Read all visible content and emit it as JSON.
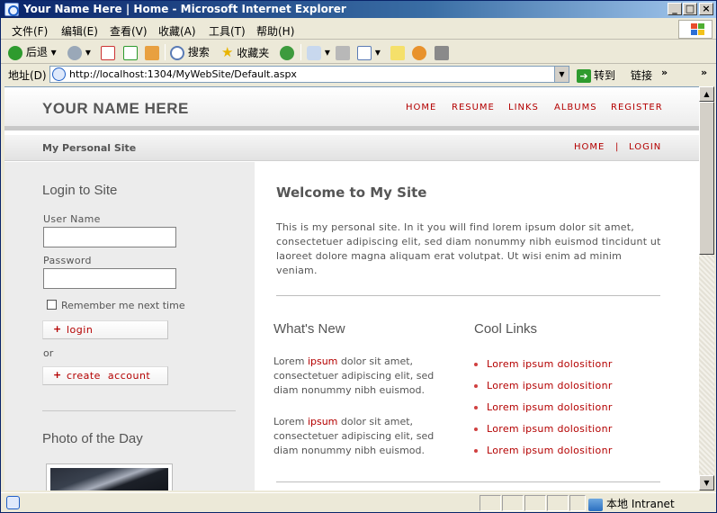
{
  "window": {
    "title": "Your Name Here | Home - Microsoft Internet Explorer",
    "minimize": "_",
    "maximize": "□",
    "close": "×"
  },
  "menu": [
    "文件(F)",
    "编辑(E)",
    "查看(V)",
    "收藏(A)",
    "工具(T)",
    "帮助(H)"
  ],
  "toolbar": {
    "back": "后退",
    "search": "搜索",
    "favorites": "收藏夹"
  },
  "address": {
    "label": "地址(D)",
    "url": "http://localhost:1304/MyWebSite/Default.aspx",
    "go": "转到",
    "links": "链接",
    "more": "»"
  },
  "site": {
    "name": "YOUR NAME HERE",
    "tagline": "My Personal Site",
    "top_nav": [
      "HOME",
      "RESUME",
      "LINKS",
      "ALBUMS",
      "REGISTER"
    ],
    "sub_nav": [
      "HOME",
      "LOGIN"
    ],
    "sub_sep": "|"
  },
  "sidebar": {
    "login_heading": "Login to Site",
    "username_label": "User Name",
    "password_label": "Password",
    "remember": "Remember me next time",
    "login_button": "login",
    "or": "or",
    "create_button": "create  account",
    "photo_heading": "Photo of the Day"
  },
  "main": {
    "welcome": "Welcome to My Site",
    "intro": "This is my personal site. In it you will find lorem ipsum dolor sit amet, consectetuer adipiscing elit, sed diam nonummy nibh euismod tincidunt ut laoreet dolore magna aliquam erat volutpat. Ut wisi enim ad minim veniam.",
    "whats_new_heading": "What's New",
    "news": [
      {
        "pre": "Lorem ",
        "hl": "ipsum",
        "post": " dolor sit amet, consectetuer adipiscing elit, sed diam nonummy nibh euismod."
      },
      {
        "pre": "Lorem ",
        "hl": "ipsum",
        "post": " dolor sit amet, consectetuer adipiscing elit, sed diam nonummy nibh euismod."
      }
    ],
    "cool_links_heading": "Cool Links",
    "cool_links": [
      "Lorem ipsum dolositionr",
      "Lorem ipsum dolositionr",
      "Lorem ipsum dolositionr",
      "Lorem ipsum dolositionr",
      "Lorem ipsum dolositionr"
    ]
  },
  "status": {
    "zone": "本地 Intranet"
  },
  "colors": {
    "accent": "#b40000",
    "titlebar": "#0a246a"
  }
}
